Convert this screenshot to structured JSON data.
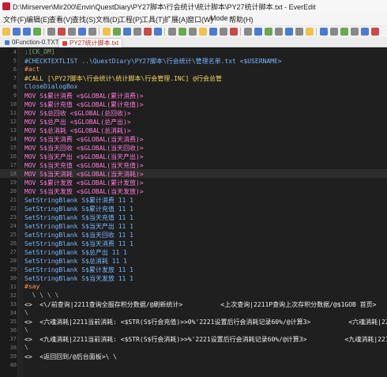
{
  "window": {
    "title": "D:\\Mirserver\\Mir200\\Envir\\QuestDiary\\PY27脚本\\行会统计\\统计脚本\\PY27统计脚本.txt - EverEdit"
  },
  "menu": [
    "文件(F)",
    "编辑(E)",
    "查看(V)",
    "查找(S)",
    "文档(D)",
    "工程(P)",
    "工具(T)",
    "扩展(A)",
    "窗口(W)",
    "Mode",
    "帮助(H)"
  ],
  "tabs": [
    {
      "label": "0Function-0.TXT"
    },
    {
      "label": "PY27统计脚本.txt"
    }
  ],
  "editor": {
    "lines": [
      {
        "n": "4",
        "text": ";[CK_DM]"
      },
      {
        "n": "5",
        "text": "#CHECKTEXTLIST ..\\QuestDiary\\PY27脚本\\行会统计\\管理名单.txt <$USERNAME>"
      },
      {
        "n": "6",
        "text": "#act"
      },
      {
        "n": "7",
        "text": "#CALL [\\PY27脚本\\行会统计\\统计脚本\\行会管理.INC] @行会总管"
      },
      {
        "n": "8",
        "text": "CloseDialogBox"
      },
      {
        "n": "9",
        "text": "MOV S$累计消费 <$GLOBAL(累计消费)>"
      },
      {
        "n": "10",
        "text": "MOV S$累计充值 <$GLOBAL(累计充值)>"
      },
      {
        "n": "11",
        "text": "MOV S$总回收 <$GLOBAL(总回收)>"
      },
      {
        "n": "12",
        "text": "MOV S$总产出 <$GLOBAL(总产出)>"
      },
      {
        "n": "13",
        "text": "MOV S$总消耗 <$GLOBAL(总消耗)>"
      },
      {
        "n": "14",
        "text": "MOV S$当天消费 <$GLOBAL(当天消费)>"
      },
      {
        "n": "15",
        "text": "MOV S$当天回收 <$GLOBAL(当天回收)>"
      },
      {
        "n": "16",
        "text": "MOV S$当天产出 <$GLOBAL(当天产出)>"
      },
      {
        "n": "17",
        "text": "MOV S$当天充值 <$GLOBAL(当天充值)>"
      },
      {
        "n": "18",
        "text": "MOV S$当天消耗 <$GLOBAL(当天消耗)>"
      },
      {
        "n": "19",
        "text": "MOV S$累计发放 <$GLOBAL(累计发放)>"
      },
      {
        "n": "20",
        "text": "MOV S$当天发放 <$GLOBAL(当天发放)>"
      },
      {
        "n": "21",
        "text": "SetStringBlank S$累计消费 11 1"
      },
      {
        "n": "22",
        "text": "SetStringBlank S$累计充值 11 1"
      },
      {
        "n": "23",
        "text": "SetStringBlank S$当天充值 11 1"
      },
      {
        "n": "24",
        "text": "SetStringBlank S$当天产出 11 1"
      },
      {
        "n": "25",
        "text": "SetStringBlank S$当天回收 11 1"
      },
      {
        "n": "26",
        "text": "SetStringBlank S$当天消费 11 1"
      },
      {
        "n": "27",
        "text": "SetStringBlank S$总产出 11 1"
      },
      {
        "n": "28",
        "text": "SetStringBlank S$总消耗 11 1"
      },
      {
        "n": "29",
        "text": "SetStringBlank S$累计发放 11 1"
      },
      {
        "n": "30",
        "text": "SetStringBlank S$当天发放 11 1"
      },
      {
        "n": "31",
        "text": "#say"
      },
      {
        "n": "32",
        "text": "  \\ \\ \\ \\"
      },
      {
        "n": "33",
        "text": "<>  <\\/前查询|2211查询全服存积分数据/@刷新统计>          <上次查询|2211P查询上次存积分数据/@$1GOB 首页>"
      },
      {
        "n": "34",
        "text": "\\"
      },
      {
        "n": "35",
        "text": "<>  <六魂消耗|2211当前消耗: <$STR(S$行会充值)>>0%'2221设置后行会消耗记录60%/@计算3>          <六魂消耗|2211当"
      },
      {
        "n": "36",
        "text": "\\"
      },
      {
        "n": "37",
        "text": "<>  <九魂消耗|2211当前消耗: <$STR(S$行会消耗)>>%'2221设置后行会消耗记录60%/@计算3>          <九魂消耗|2211当"
      },
      {
        "n": "38",
        "text": "\\"
      },
      {
        "n": "39",
        "text": "<>  <返回回到/@后台面板>\\ \\"
      },
      {
        "n": "40",
        "text": ""
      }
    ]
  },
  "colors": {
    "background": "#1f1f1f",
    "accent": "#c41e3a"
  }
}
